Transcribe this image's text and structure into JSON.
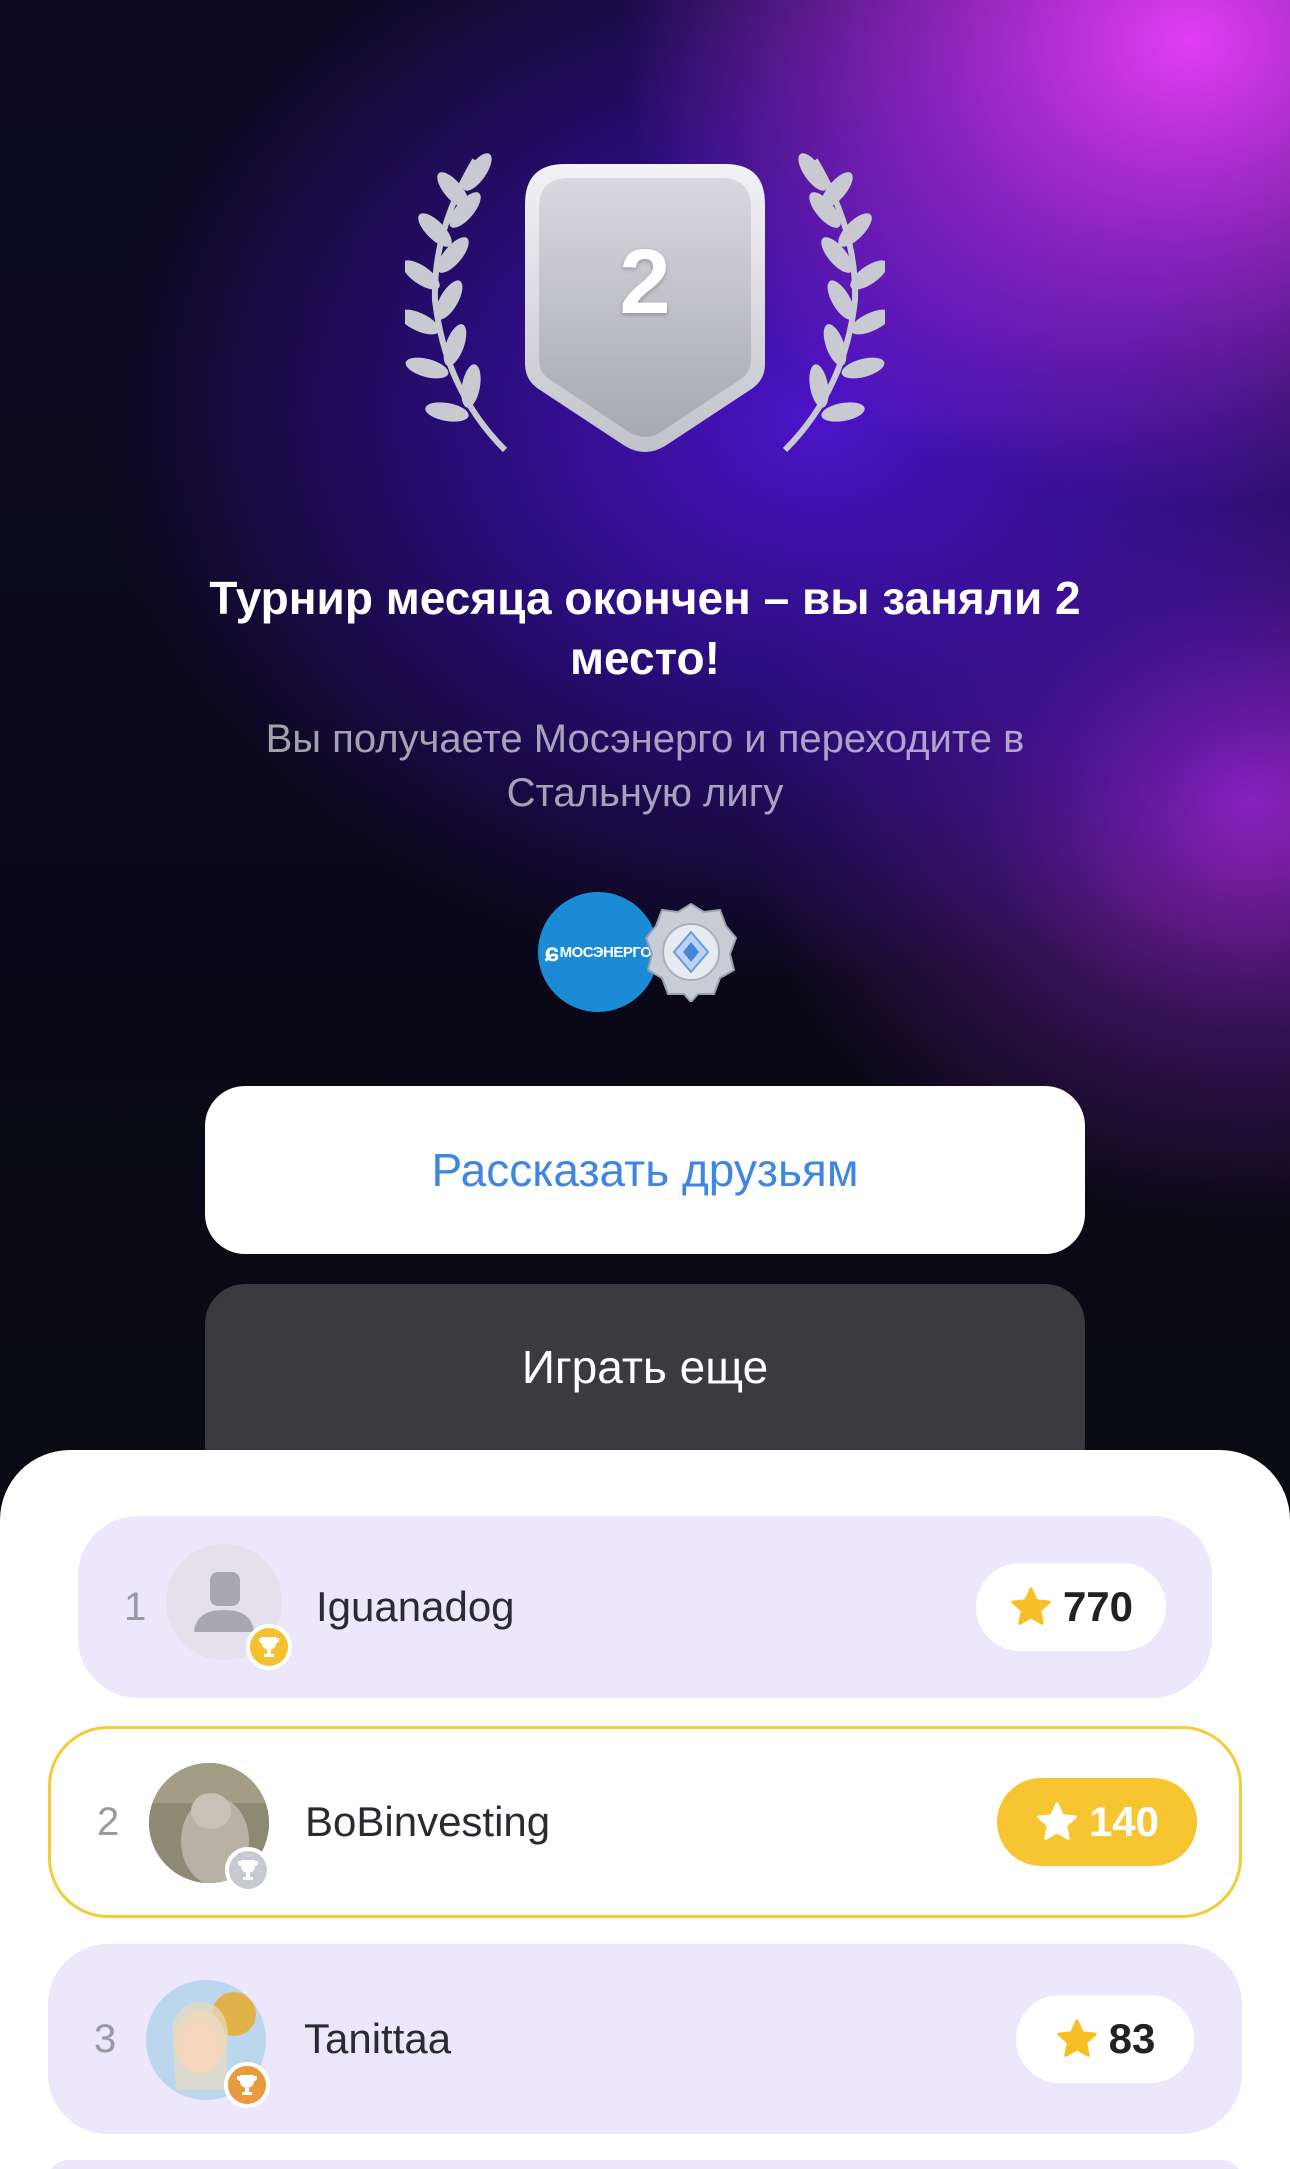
{
  "result": {
    "place_number": "2",
    "title": "Турнир месяца окончен – вы заняли 2 место!",
    "subtitle": "Вы получаете Мосэнерго и переходите в Стальную лигу"
  },
  "rewards": {
    "stock_logo_text": "МОСЭНЕРГО",
    "league_icon": "steel-league-badge-icon"
  },
  "buttons": {
    "share_label": "Рассказать друзьям",
    "play_label": "Играть еще"
  },
  "leaderboard": [
    {
      "rank": "1",
      "name": "Iguanadog",
      "score": "770",
      "trophy": "gold"
    },
    {
      "rank": "2",
      "name": "BoBinvesting",
      "score": "140",
      "trophy": "silver",
      "current_user": true
    },
    {
      "rank": "3",
      "name": "Tanittaa",
      "score": "83",
      "trophy": "bronze"
    }
  ],
  "colors": {
    "accent_blue": "#3f86e0",
    "gold": "#f7c531",
    "row_lavender": "#ece7fb",
    "highlight_border": "#f4cb3a"
  }
}
